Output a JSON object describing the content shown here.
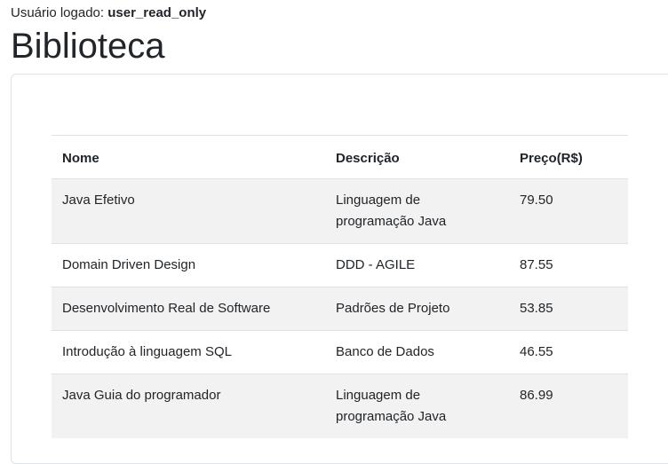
{
  "session": {
    "label": "Usuário logado:",
    "username": "user_read_only"
  },
  "page": {
    "title": "Biblioteca"
  },
  "table": {
    "headers": [
      "Nome",
      "Descrição",
      "Preço(R$)"
    ],
    "rows": [
      {
        "nome": "Java Efetivo",
        "descricao": "Linguagem de programação Java",
        "preco": "79.50"
      },
      {
        "nome": "Domain Driven Design",
        "descricao": "DDD - AGILE",
        "preco": "87.55"
      },
      {
        "nome": "Desenvolvimento Real de Software",
        "descricao": "Padrões de Projeto",
        "preco": "53.85"
      },
      {
        "nome": "Introdução à linguagem SQL",
        "descricao": "Banco de Dados",
        "preco": "46.55"
      },
      {
        "nome": "Java Guia do programador",
        "descricao": "Linguagem de programação Java",
        "preco": "86.99"
      }
    ]
  }
}
